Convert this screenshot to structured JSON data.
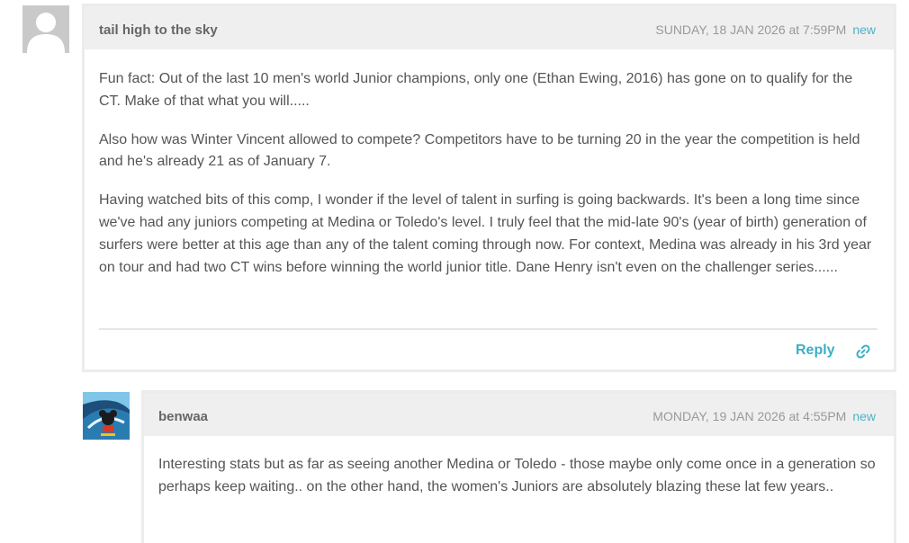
{
  "comments": [
    {
      "author": "tail high to the sky",
      "date": "SUNDAY, 18 JAN 2026 at 7:59PM",
      "new_label": "new",
      "paragraphs": [
        "Fun fact: Out of the last 10 men's world Junior champions, only one (Ethan Ewing, 2016) has gone on to qualify for the CT. Make of that what you will.....",
        "Also how was Winter Vincent allowed to compete? Competitors have to be turning 20 in the year the competition is held and he's already 21 as of January 7.",
        "Having watched bits of this comp, I wonder if the level of talent in surfing is going backwards. It's been a long time since we've had any juniors competing at Medina or Toledo's level. I truly feel that the mid-late 90's (year of birth) generation of surfers were better at this age than any of the talent coming through now. For context, Medina was already in his 3rd year on tour and had two CT wins before winning the world junior title. Dane Henry isn't even on the challenger series......"
      ],
      "reply_label": "Reply",
      "avatar_icon": "default-user-avatar",
      "link_icon": "link-icon"
    },
    {
      "author": "benwaa",
      "date": "MONDAY, 19 JAN 2026 at 4:55PM",
      "new_label": "new",
      "paragraphs": [
        "Interesting stats but as far as seeing another Medina or Toledo - those maybe only come once in a generation so perhaps keep waiting.. on the other hand, the women's Juniors are absolutely blazing these lat few years.."
      ],
      "avatar_icon": "surf-picture-avatar"
    }
  ],
  "colors": {
    "accent": "#3ab0c4",
    "header_bg": "#efefef",
    "border": "#ececec",
    "text": "#555555",
    "meta": "#999999"
  }
}
